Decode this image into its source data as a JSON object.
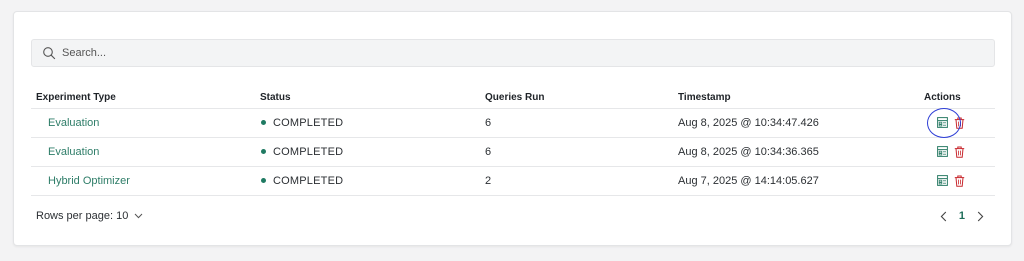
{
  "search": {
    "placeholder": "Search..."
  },
  "table": {
    "headers": {
      "experiment_type": "Experiment Type",
      "status": "Status",
      "queries_run": "Queries Run",
      "timestamp": "Timestamp",
      "actions": "Actions"
    },
    "rows": [
      {
        "experiment_type": "Evaluation",
        "status": "COMPLETED",
        "queries_run": "6",
        "timestamp": "Aug 8, 2025 @ 10:34:47.426"
      },
      {
        "experiment_type": "Evaluation",
        "status": "COMPLETED",
        "queries_run": "6",
        "timestamp": "Aug 8, 2025 @ 10:34:36.365"
      },
      {
        "experiment_type": "Hybrid Optimizer",
        "status": "COMPLETED",
        "queries_run": "2",
        "timestamp": "Aug 7, 2025 @ 14:14:05.627"
      }
    ]
  },
  "footer": {
    "rows_per_page": "Rows per page: 10",
    "current_page": "1"
  },
  "icons": {
    "search": "search-icon",
    "view": "report-view-icon",
    "delete": "trash-icon",
    "dropdown": "chevron-down-icon",
    "prev": "chevron-left-icon",
    "next": "chevron-right-icon"
  },
  "colors": {
    "link": "#2e7d68",
    "status_dot": "#1f7a62",
    "view_icon": "#2e7d68",
    "delete_icon": "#c8282e",
    "highlight": "#2f3fd6",
    "page_active": "#1f6e5a"
  }
}
